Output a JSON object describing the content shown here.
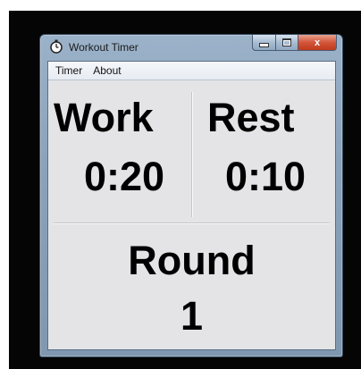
{
  "window": {
    "title": "Workout Timer",
    "icon": "stopwatch-icon"
  },
  "caption_buttons": {
    "close_label": "x"
  },
  "menu": [
    "Timer",
    "About"
  ],
  "timer": {
    "work_label": "Work",
    "work_time": "0:20",
    "rest_label": "Rest",
    "rest_time": "0:10",
    "round_label": "Round",
    "round_value": "1"
  },
  "colors": {
    "backdrop": "#050505",
    "client_bg": "#e4e4e6",
    "close_button": "#d4553a"
  }
}
